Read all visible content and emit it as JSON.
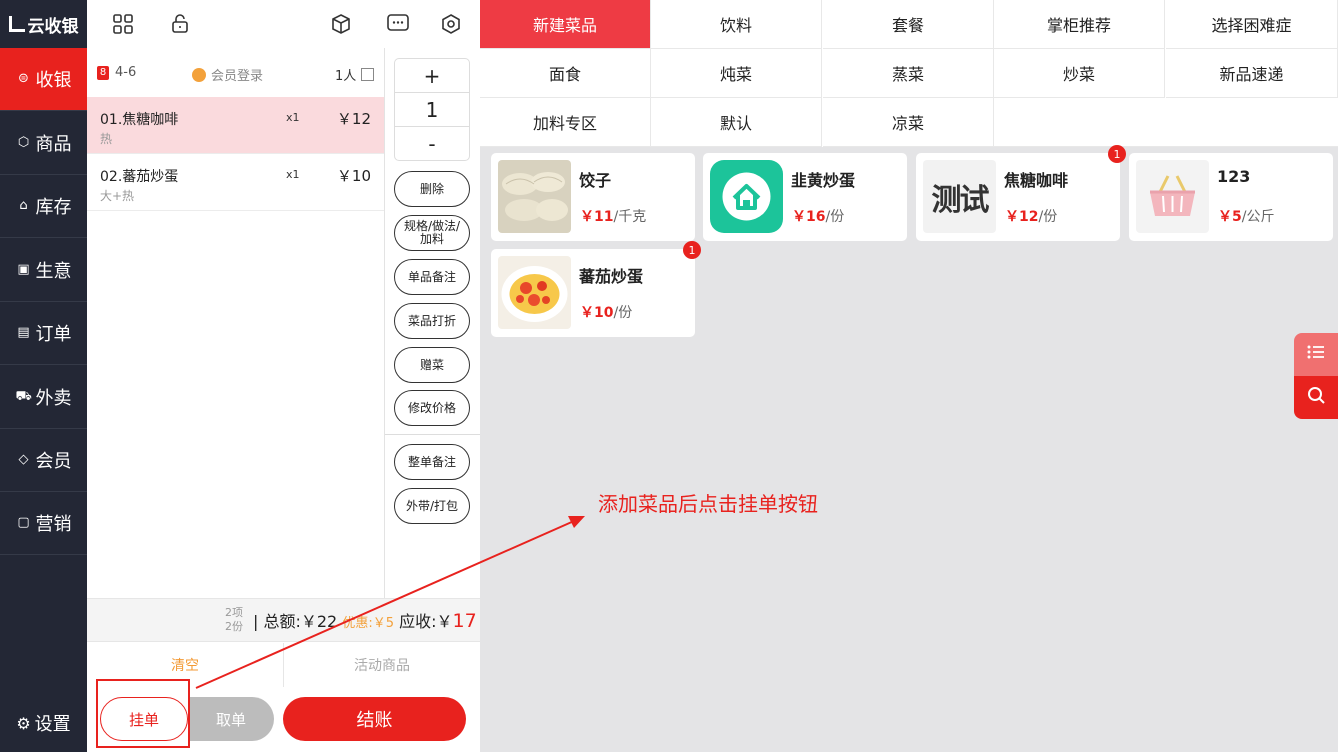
{
  "app": {
    "logo_text": "云收银"
  },
  "sidebar": {
    "items": [
      {
        "label": "收银",
        "icon": "cashier-icon"
      },
      {
        "label": "商品",
        "icon": "cube-icon"
      },
      {
        "label": "库存",
        "icon": "store-icon"
      },
      {
        "label": "生意",
        "icon": "chart-icon"
      },
      {
        "label": "订单",
        "icon": "order-icon"
      },
      {
        "label": "外卖",
        "icon": "delivery-icon"
      },
      {
        "label": "会员",
        "icon": "diamond-icon"
      },
      {
        "label": "营销",
        "icon": "marketing-icon"
      }
    ],
    "settings_label": "设置",
    "active_color": "#e8221e"
  },
  "order": {
    "table_badge": "8",
    "table": "4-6",
    "member_login": "会员登录",
    "persons": "1人",
    "items": [
      {
        "name": "01.焦糖咖啡",
        "note": "热",
        "qty": "x1",
        "price": "￥12"
      },
      {
        "name": "02.蕃茄炒蛋",
        "note": "大+热",
        "qty": "x1",
        "price": "￥10"
      }
    ],
    "stepper": {
      "plus": "+",
      "value": "1",
      "minus": "-"
    },
    "actions": [
      "删除",
      "规格/做法/加料",
      "单品备注",
      "菜品打折",
      "赠菜",
      "修改价格"
    ],
    "actions2": [
      "整单备注",
      "外带/打包"
    ],
    "summary": {
      "count_items": "2项",
      "count_parts": "2份",
      "total_label": "总额:￥22",
      "discount_label": "优惠:￥5",
      "due_label": "应收:￥",
      "due_value": "17"
    },
    "tabs": {
      "clear": "清空",
      "activity": "活动商品"
    },
    "buttons": {
      "hold": "挂单",
      "take": "取单",
      "pay": "结账"
    }
  },
  "categories": [
    "新建菜品",
    "饮料",
    "套餐",
    "掌柜推荐",
    "选择困难症",
    "面食",
    "炖菜",
    "蒸菜",
    "炒菜",
    "新品速递",
    "加料专区",
    "默认",
    "凉菜"
  ],
  "products": [
    {
      "name": "饺子",
      "price": "￥11",
      "unit": "/千克",
      "badge": ""
    },
    {
      "name": "韭黄炒蛋",
      "price": "￥16",
      "unit": "/份",
      "badge": ""
    },
    {
      "name": "焦糖咖啡",
      "price": "￥12",
      "unit": "/份",
      "badge": "1",
      "thumb_text": "测试"
    },
    {
      "name": "123",
      "price": "￥5",
      "unit": "/公斤",
      "badge": ""
    },
    {
      "name": "蕃茄炒蛋",
      "price": "￥10",
      "unit": "/份",
      "badge": "1"
    }
  ],
  "annotation": "添加菜品后点击挂单按钮",
  "colors": {
    "brand_red": "#e8221e",
    "category_active": "#ee3b44",
    "discount_orange": "#f3a13b",
    "sidebar_bg": "#232735"
  }
}
